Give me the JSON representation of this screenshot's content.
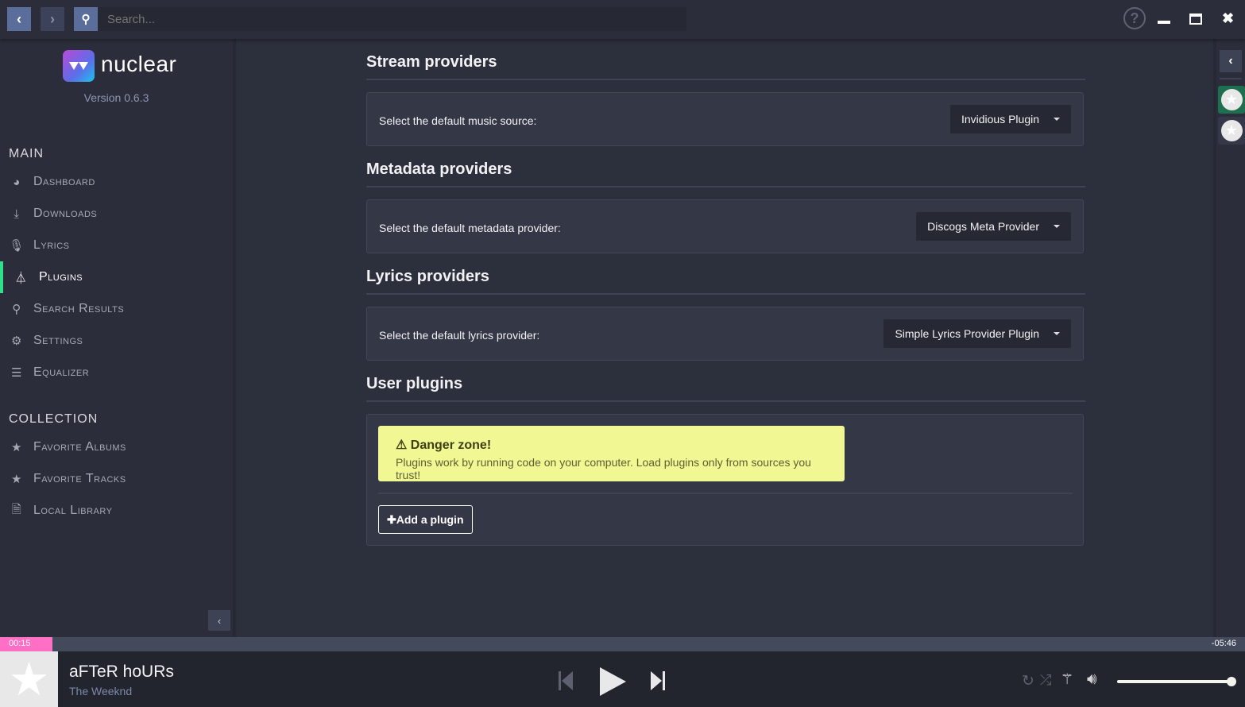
{
  "topbar": {
    "search_placeholder": "Search...",
    "icons": [
      "chevron-left-icon",
      "chevron-right-icon",
      "search-icon",
      "help-icon",
      "minimize-icon",
      "maximize-icon",
      "close-icon"
    ]
  },
  "sidebar": {
    "app_name": "nuclear",
    "version": "Version 0.6.3",
    "main_header": "MAIN",
    "main_items": [
      {
        "label": "Dashboard",
        "icon": "dashboard-icon"
      },
      {
        "label": "Downloads",
        "icon": "download-icon"
      },
      {
        "label": "Lyrics",
        "icon": "microphone-icon"
      },
      {
        "label": "Plugins",
        "icon": "flask-icon",
        "active": true
      },
      {
        "label": "Search Results",
        "icon": "search-icon"
      },
      {
        "label": "Settings",
        "icon": "cogs-icon"
      },
      {
        "label": "Equalizer",
        "icon": "sliders-icon"
      }
    ],
    "collection_header": "COLLECTION",
    "collection_items": [
      {
        "label": "Favorite Albums",
        "icon": "star-icon"
      },
      {
        "label": "Favorite Tracks",
        "icon": "star-icon"
      },
      {
        "label": "Local Library",
        "icon": "audio-file-icon"
      }
    ]
  },
  "main": {
    "stream": {
      "title": "Stream providers",
      "label": "Select the default music source:",
      "value": "Invidious Plugin"
    },
    "metadata": {
      "title": "Metadata providers",
      "label": "Select the default metadata provider:",
      "value": "Discogs Meta Provider"
    },
    "lyrics": {
      "title": "Lyrics providers",
      "label": "Select the default lyrics provider:",
      "value": "Simple Lyrics Provider Plugin"
    },
    "user": {
      "title": "User plugins",
      "danger_title": "Danger zone!",
      "danger_message": "Plugins work by running code on your computer. Load plugins only from sources you trust!",
      "add_label": "Add a plugin"
    }
  },
  "player": {
    "elapsed": "00:15",
    "remaining": "-05:46",
    "progress_percent": 4.2,
    "track": "aFTeR hoURs",
    "artist": "The Weeknd",
    "volume_percent": 100,
    "accent": "#ff6fc6"
  },
  "colors": {
    "active_indicator": "#2ee08a",
    "danger_bg": "#f1f793",
    "queue_active": "#1e6e50"
  }
}
